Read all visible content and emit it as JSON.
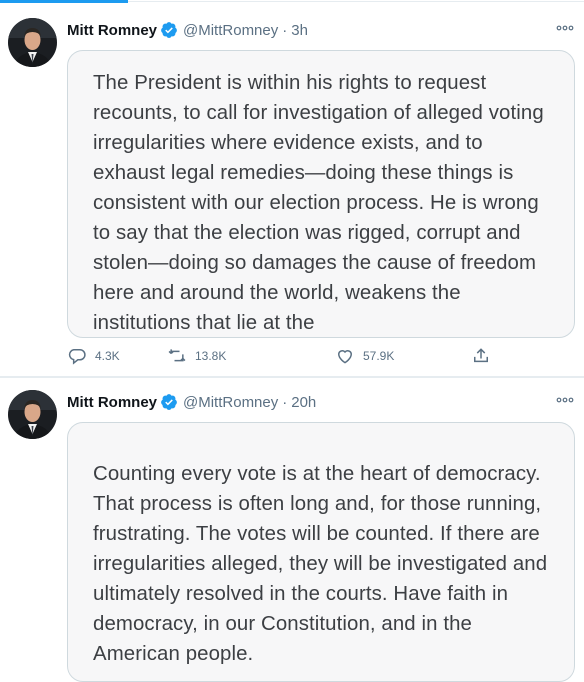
{
  "tweets": [
    {
      "name": "Mitt Romney",
      "handle": "@MittRomney",
      "separator": "·",
      "time": "3h",
      "text": "The President is within his rights to request recounts, to call for investigation of alleged voting irregularities where evidence exists, and to exhaust legal remedies—doing these things is consistent with our election process. He is wrong to say that the election was rigged, corrupt and stolen—doing so damages the cause of freedom here and around the world, weakens the institutions that lie at the",
      "replies": "4.3K",
      "retweets": "13.8K",
      "likes": "57.9K"
    },
    {
      "name": "Mitt Romney",
      "handle": "@MittRomney",
      "separator": "·",
      "time": "20h",
      "text": "Counting every vote is at the heart of democracy. That process is often long and, for those running, frustrating. The votes will be counted. If there are irregularities alleged, they will be investigated and ultimately resolved in the courts. Have faith in democracy, in our Constitution, and in the American people."
    }
  ],
  "icons": {
    "verified": "verified-badge-icon",
    "more": "more-options-icon",
    "reply": "reply-icon",
    "retweet": "retweet-icon",
    "like": "heart-icon",
    "share": "share-icon"
  },
  "colors": {
    "accent": "#1d9bf0",
    "secondary_text": "#5b7083",
    "card_background": "#f7f7f8",
    "card_border": "#cfd9de"
  }
}
